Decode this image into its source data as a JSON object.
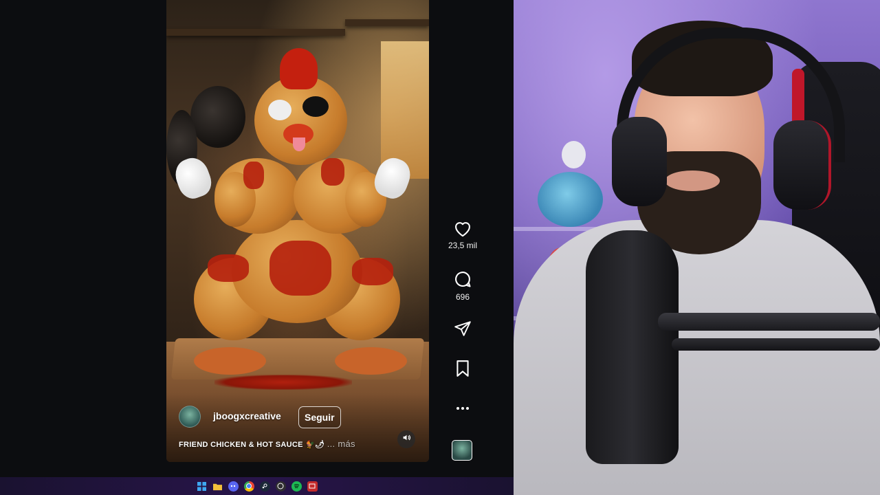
{
  "reel": {
    "author": "jboogxcreative",
    "follow_label": "Seguir",
    "caption_text": "FRIEND CHICKEN & HOT SAUCE 🐓🌶",
    "caption_more": "... más"
  },
  "actions": {
    "likes": "23,5 mil",
    "comments": "696"
  },
  "icons": {
    "like": "heart-icon",
    "comment": "comment-icon",
    "share": "send-icon",
    "save": "bookmark-icon",
    "more": "more-icon",
    "sound": "speaker-icon"
  },
  "taskbar": {
    "icons": [
      "windows-start-icon",
      "file-explorer-icon",
      "discord-icon",
      "chrome-icon",
      "steam-icon",
      "obs-icon",
      "spotify-icon",
      "app-icon"
    ]
  },
  "colors": {
    "background": "#0c0d10",
    "webcam_light": "#8f76cf",
    "taskbar": "#28154a"
  }
}
